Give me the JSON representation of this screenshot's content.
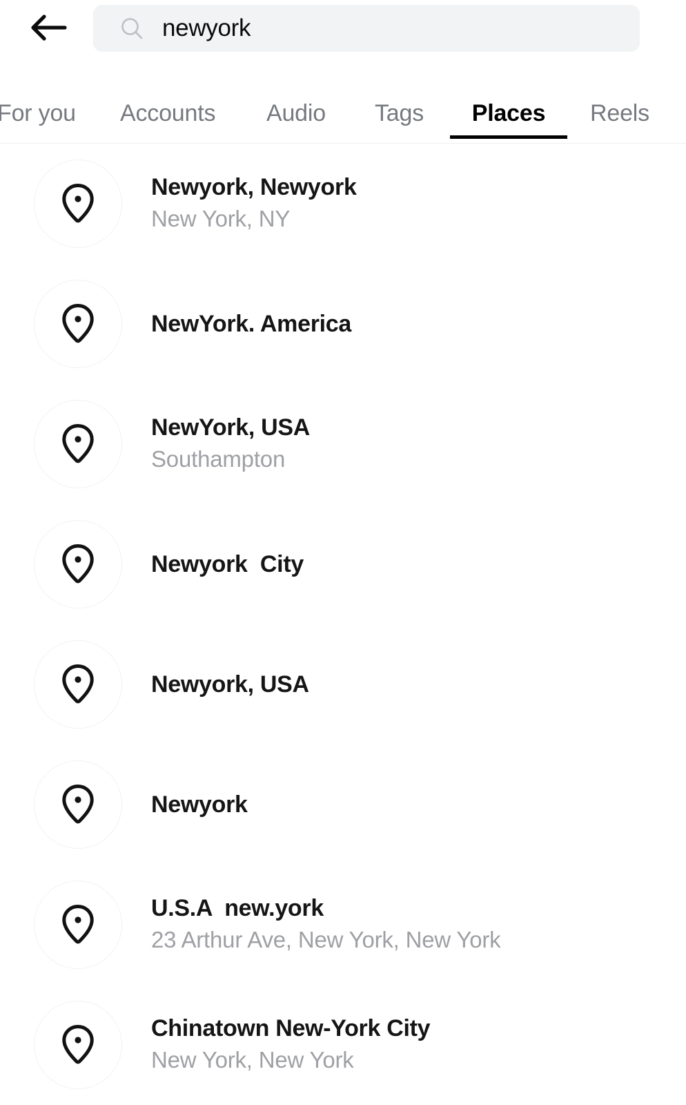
{
  "header": {
    "back_icon": "arrow-left-icon",
    "search": {
      "icon": "search-icon",
      "value": "newyork",
      "placeholder": "Search"
    }
  },
  "tabs": {
    "items": [
      {
        "label": "For you",
        "active": false
      },
      {
        "label": "Accounts",
        "active": false
      },
      {
        "label": "Audio",
        "active": false
      },
      {
        "label": "Tags",
        "active": false
      },
      {
        "label": "Places",
        "active": true
      },
      {
        "label": "Reels",
        "active": false
      }
    ],
    "active_label": "Places"
  },
  "results": {
    "icon": "location-pin-icon",
    "items": [
      {
        "title": "Newyork, Newyork",
        "subtitle": "New York, NY"
      },
      {
        "title": "NewYork. America",
        "subtitle": ""
      },
      {
        "title": "NewYork, USA",
        "subtitle": "Southampton"
      },
      {
        "title": "Newyork  City",
        "subtitle": ""
      },
      {
        "title": "Newyork, USA",
        "subtitle": ""
      },
      {
        "title": "Newyork",
        "subtitle": ""
      },
      {
        "title": "U.S.A  new.york",
        "subtitle": "23 Arthur Ave, New York, New York"
      },
      {
        "title": "Chinatown New-York City",
        "subtitle": "New York, New York"
      }
    ]
  },
  "colors": {
    "background": "#ffffff",
    "search_field_bg": "#f2f3f5",
    "tab_inactive": "#76797f",
    "tab_active": "#000000",
    "title_text": "#151515",
    "subtitle_text": "#9ea0a4",
    "divider": "#efefef",
    "pin_circle_border": "#f2f2f2"
  }
}
